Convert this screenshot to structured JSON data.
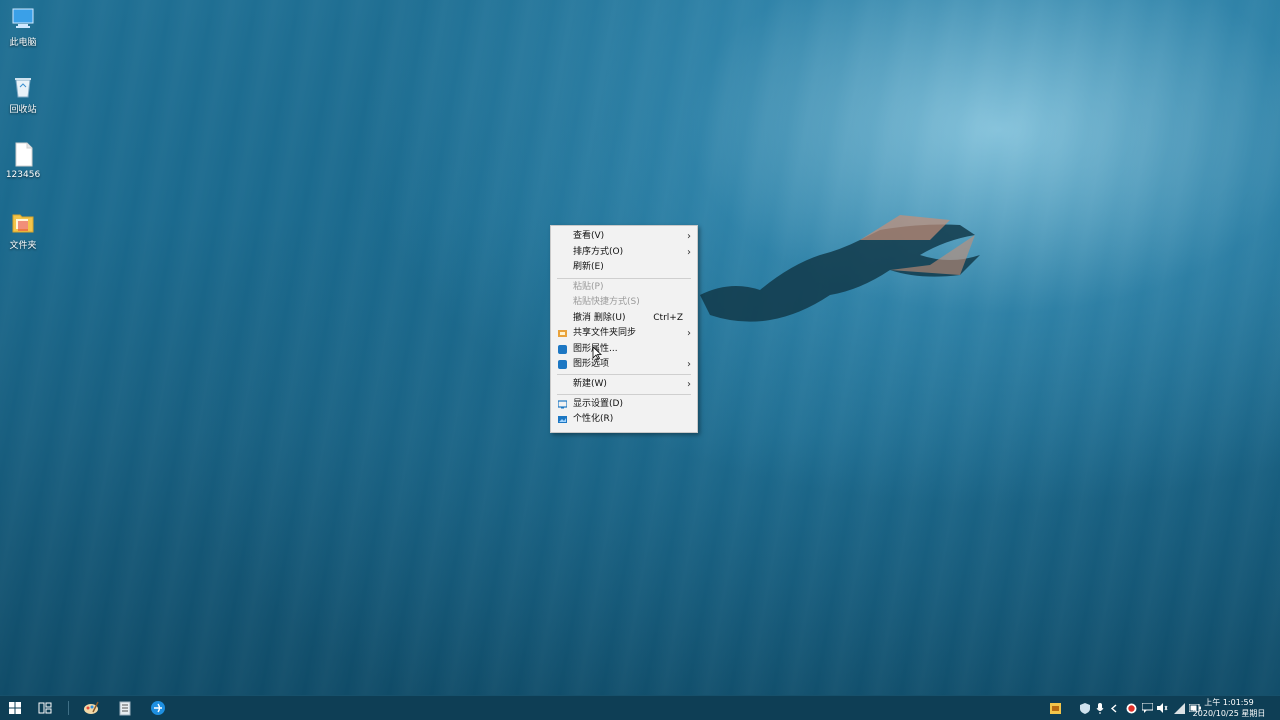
{
  "desktop": {
    "icons": [
      {
        "label": "此电脑",
        "icon": "computer-icon"
      },
      {
        "label": "回收站",
        "icon": "recycle-bin-icon"
      },
      {
        "label": "123456",
        "icon": "document-icon"
      },
      {
        "label": "文件夹",
        "icon": "folder-icon"
      }
    ]
  },
  "context_menu": {
    "items": [
      {
        "label": "查看(V)",
        "submenu": true
      },
      {
        "label": "排序方式(O)",
        "submenu": true
      },
      {
        "label": "刷新(E)"
      },
      {
        "label": "粘贴(P)",
        "disabled": true
      },
      {
        "label": "粘贴快捷方式(S)",
        "disabled": true
      },
      {
        "label": "撤消 删除(U)",
        "shortcut": "Ctrl+Z"
      },
      {
        "label": "共享文件夹同步",
        "submenu": true,
        "icon": "share-sync-icon"
      },
      {
        "label": "图形属性...",
        "icon": "graphics-properties-icon"
      },
      {
        "label": "图形选项",
        "submenu": true,
        "icon": "graphics-options-icon"
      },
      {
        "label": "新建(W)",
        "submenu": true
      },
      {
        "label": "显示设置(D)",
        "icon": "display-settings-icon"
      },
      {
        "label": "个性化(R)",
        "icon": "personalize-icon"
      }
    ]
  },
  "taskbar": {
    "pinned": [
      "start-icon",
      "task-view-icon",
      "paint-app-icon",
      "notepad-app-icon",
      "browser-app-icon"
    ],
    "tray": [
      "ime-icon",
      "security-icon",
      "microphone-icon",
      "chevron-left-icon",
      "record-icon",
      "chat-icon",
      "volume-icon",
      "network-icon",
      "battery-icon"
    ],
    "clock": {
      "time": "上午 1:01:59",
      "date": "2020/10/25 星期日"
    }
  },
  "colors": {
    "accent": "#1c77c3",
    "taskbar": "#0e3e55",
    "menu_bg": "#f2f2f2"
  }
}
